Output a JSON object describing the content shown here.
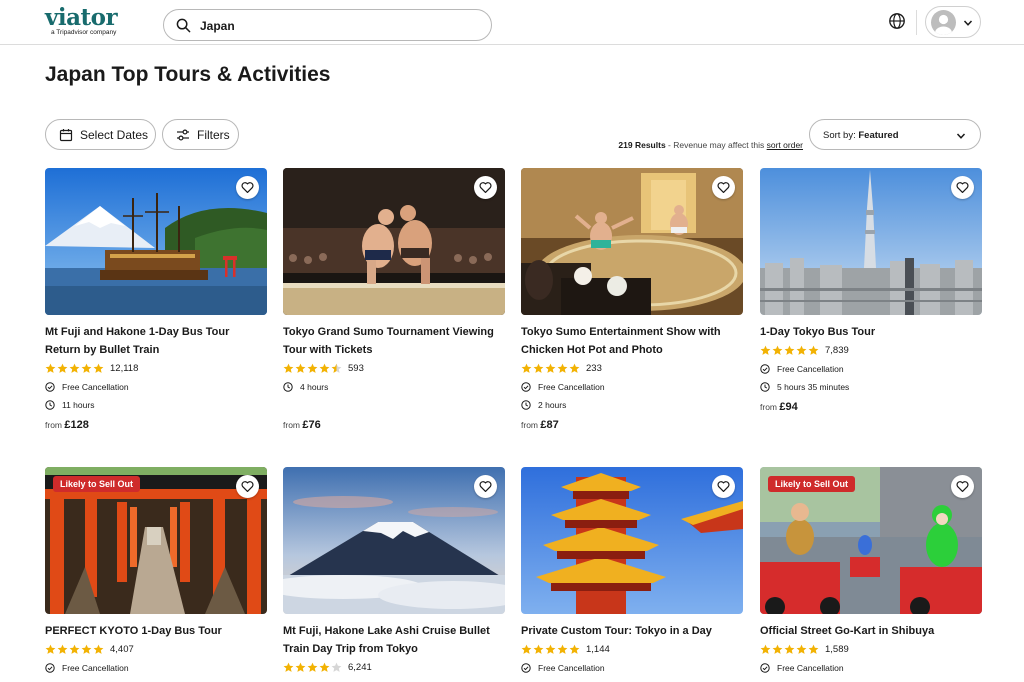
{
  "header": {
    "logo_word": "viator",
    "logo_sub": "a Tripadvisor company",
    "search_value": "Japan"
  },
  "page": {
    "title": "Japan Top Tours & Activities"
  },
  "toolbar": {
    "select_dates_label": "Select Dates",
    "filters_label": "Filters",
    "results_count": "219 Results",
    "results_note": " - Revenue may affect this ",
    "results_link": "sort order",
    "sort_prefix": "Sort by: ",
    "sort_value": "Featured"
  },
  "colors": {
    "brand": "#186b6d",
    "star": "#f2b203",
    "badge": "#cf2b2b"
  },
  "cards": [
    {
      "title": "Mt Fuji and Hakone 1-Day Bus Tour Return by Bullet Train",
      "rating_value": 5,
      "review_count": "12,118",
      "cancellation": "Free Cancellation",
      "duration": "11 hours",
      "price_prefix": "from ",
      "price": "£128"
    },
    {
      "title": "Tokyo Grand Sumo Tournament Viewing Tour with Tickets",
      "rating_value": 4.5,
      "review_count": "593",
      "duration": "4 hours",
      "price_prefix": "from ",
      "price": "£76"
    },
    {
      "title": "Tokyo Sumo Entertainment Show with Chicken Hot Pot and Photo",
      "rating_value": 5,
      "review_count": "233",
      "cancellation": "Free Cancellation",
      "duration": "2 hours",
      "price_prefix": "from ",
      "price": "£87"
    },
    {
      "title": "1-Day Tokyo Bus Tour",
      "rating_value": 5,
      "review_count": "7,839",
      "cancellation": "Free Cancellation",
      "duration": "5 hours 35 minutes",
      "price_prefix": "from ",
      "price": "£94"
    },
    {
      "badge": "Likely to Sell Out",
      "title": "PERFECT KYOTO 1-Day Bus Tour",
      "rating_value": 5,
      "review_count": "4,407",
      "cancellation": "Free Cancellation"
    },
    {
      "title": "Mt Fuji, Hakone Lake Ashi Cruise Bullet Train Day Trip from Tokyo",
      "rating_value": 4,
      "review_count": "6,241"
    },
    {
      "title": "Private Custom Tour: Tokyo in a Day",
      "rating_value": 5,
      "review_count": "1,144",
      "cancellation": "Free Cancellation"
    },
    {
      "badge": "Likely to Sell Out",
      "title": "Official Street Go-Kart in Shibuya",
      "rating_value": 5,
      "review_count": "1,589",
      "cancellation": "Free Cancellation"
    }
  ]
}
